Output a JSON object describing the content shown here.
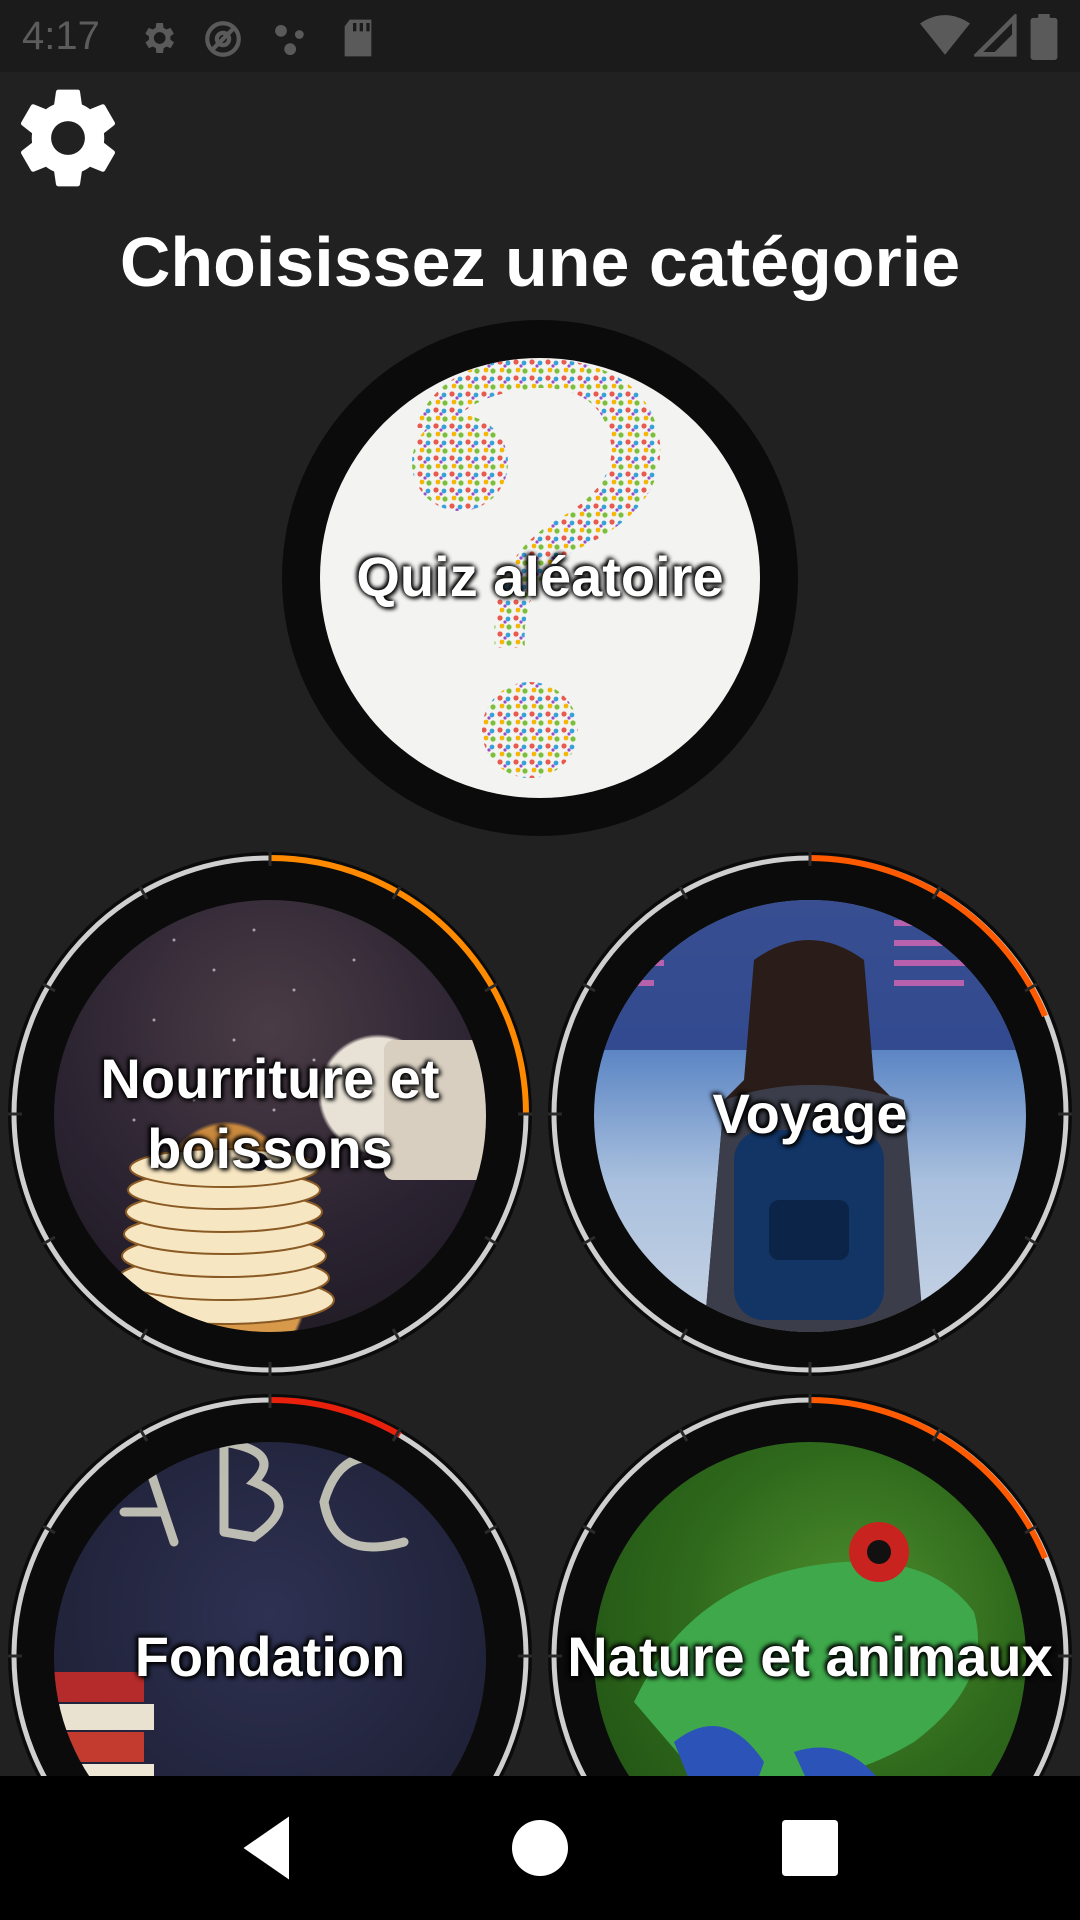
{
  "status_bar": {
    "time": "4:17",
    "icons": [
      "settings-icon",
      "at-sign-icon",
      "dots-icon",
      "sd-card-icon",
      "wifi-icon",
      "signal-icon",
      "battery-icon"
    ]
  },
  "header": {
    "settings_icon": "gear-icon",
    "title": "Choisissez une catégorie"
  },
  "categories": [
    {
      "label": "Quiz aléatoire",
      "image": "question-mark-mosaic"
    },
    {
      "label": "Nourriture et boissons",
      "label_line1": "Nourriture et",
      "label_line2": "boissons",
      "image": "pancakes-with-sugar",
      "progress_color": "#ff8a00"
    },
    {
      "label": "Voyage",
      "image": "traveler-airport-departures",
      "progress_color": "#ff5a00"
    },
    {
      "label": "Fondation",
      "image": "chalkboard-abc-books",
      "progress_color": "#e8200c"
    },
    {
      "label": "Nature et animaux",
      "image": "red-eyed-tree-frog",
      "progress_color": "#ff5a00"
    }
  ],
  "nav_bar": {
    "back": "back-icon",
    "home": "home-icon",
    "recents": "recents-icon"
  }
}
